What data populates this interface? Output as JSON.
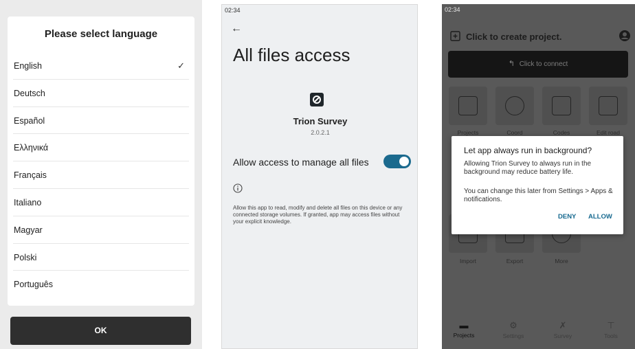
{
  "language_screen": {
    "title": "Please select language",
    "languages": [
      "English",
      "Deutsch",
      "Español",
      "Ελληνικά",
      "Français",
      "Italiano",
      "Magyar",
      "Polski",
      "Português"
    ],
    "selected": "English",
    "ok_label": "OK"
  },
  "files_screen": {
    "status_time": "02:34",
    "title": "All files access",
    "app_name": "Trion Survey",
    "app_version": "2.0.2.1",
    "allow_label": "Allow access to manage all files",
    "toggle_on": true,
    "description": "Allow this app to read, modify and delete all files on this device or any connected storage volumes. If granted, app may access files without your explicit knowledge."
  },
  "dashboard_screen": {
    "status_time": "02:34",
    "header_title": "Click to create project.",
    "connect_label": "Click to connect",
    "tiles_row1": [
      "Projects",
      "Coord",
      "Codes",
      "Edit road"
    ],
    "tiles_row2": [
      "Import",
      "Export",
      "More"
    ],
    "nav": [
      "Projects",
      "Settings",
      "Survey",
      "Tools"
    ],
    "dialog": {
      "title": "Let app always run in background?",
      "body1": "Allowing Trion Survey to always run in the background may reduce battery life.",
      "body2": "You can change this later from Settings > Apps & notifications.",
      "deny": "DENY",
      "allow": "ALLOW"
    },
    "colors": {
      "accent": "#16698f",
      "toggle": "#1b6a8e"
    }
  }
}
